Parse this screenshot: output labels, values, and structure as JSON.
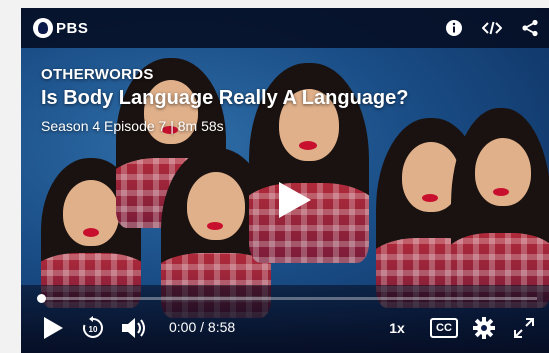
{
  "brand": {
    "logo_text": "PBS",
    "logo_icon": "pbs-head-icon"
  },
  "top_icons": [
    "info-icon",
    "embed-icon",
    "share-icon"
  ],
  "episode": {
    "show": "OTHERWORDS",
    "title": "Is Body Language Really A Language?",
    "meta": "Season 4 Episode 7 | 8m 58s"
  },
  "player": {
    "current_time": "0:00",
    "separator": "/",
    "duration": "8:58",
    "speed": "1x",
    "cc_label": "CC",
    "progress_fraction": 0.0
  },
  "colors": {
    "topbar_bg": "#050a1e",
    "accent_white": "#ffffff",
    "lipstick": "#c8102e"
  }
}
